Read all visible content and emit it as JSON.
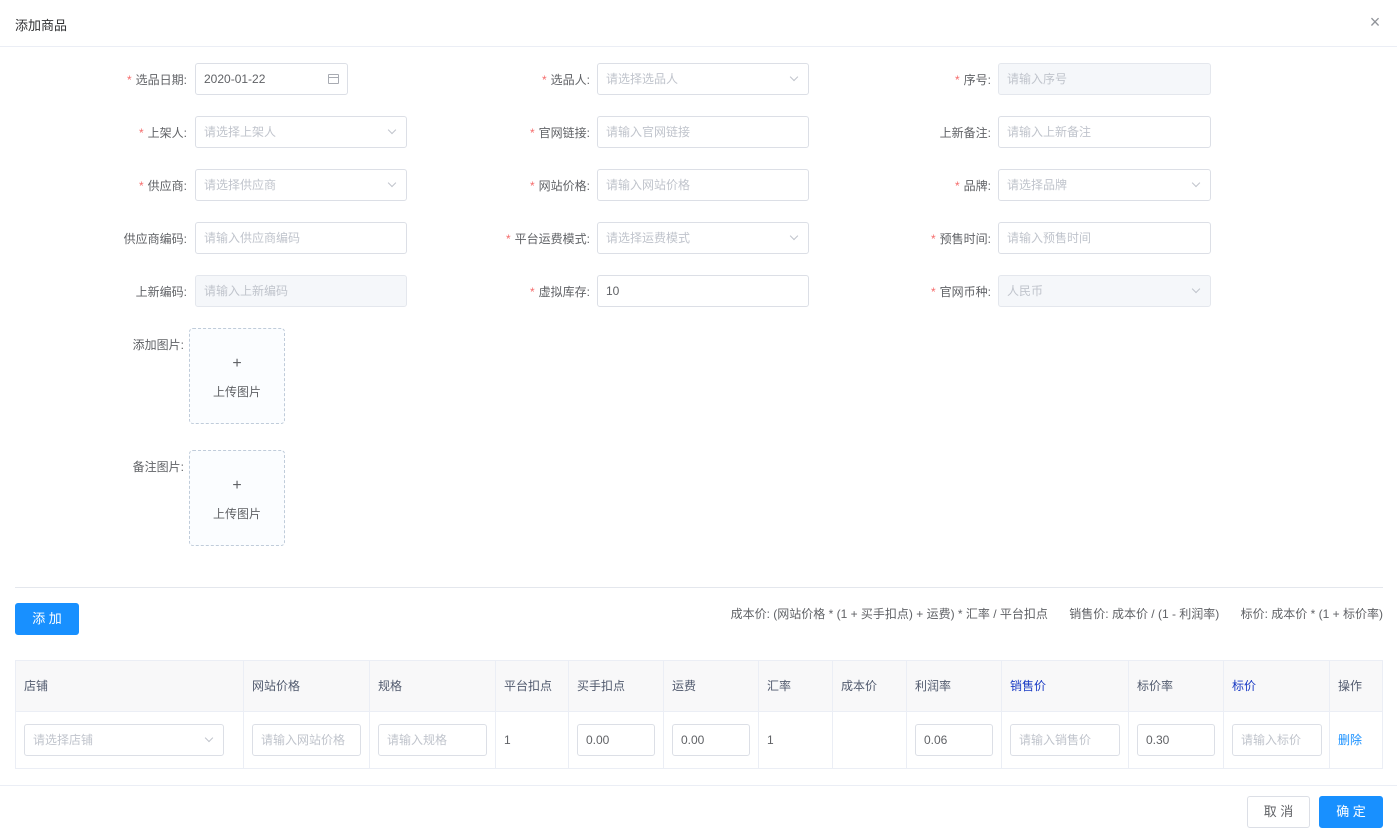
{
  "dialog": {
    "title": "添加商品"
  },
  "form": {
    "select_date": {
      "label": "选品日期",
      "value": "2020-01-22"
    },
    "selector": {
      "label": "选品人",
      "placeholder": "请选择选品人"
    },
    "serial": {
      "label": "序号",
      "placeholder": "请输入序号"
    },
    "shelver": {
      "label": "上架人",
      "placeholder": "请选择上架人"
    },
    "official_link": {
      "label": "官网链接",
      "placeholder": "请输入官网链接"
    },
    "new_remark": {
      "label": "上新备注",
      "placeholder": "请输入上新备注"
    },
    "supplier": {
      "label": "供应商",
      "placeholder": "请选择供应商"
    },
    "site_price": {
      "label": "网站价格",
      "placeholder": "请输入网站价格"
    },
    "brand": {
      "label": "品牌",
      "placeholder": "请选择品牌"
    },
    "supplier_code": {
      "label": "供应商编码",
      "placeholder": "请输入供应商编码"
    },
    "shipping_mode": {
      "label": "平台运费模式",
      "placeholder": "请选择运费模式"
    },
    "presale_time": {
      "label": "预售时间",
      "placeholder": "请输入预售时间"
    },
    "new_code": {
      "label": "上新编码",
      "placeholder": "请输入上新编码"
    },
    "virtual_stock": {
      "label": "虚拟库存",
      "value": "10"
    },
    "currency": {
      "label": "官网币种",
      "value": "人民币"
    },
    "add_image": {
      "label": "添加图片",
      "upload_text": "上传图片"
    },
    "remark_image": {
      "label": "备注图片",
      "upload_text": "上传图片"
    }
  },
  "add_button": "添 加",
  "formulas": {
    "cost": "成本价:   (网站价格 * (1 + 买手扣点) + 运费) * 汇率 / 平台扣点",
    "sale": "销售价:   成本价 / (1 - 利润率)",
    "tag": "标价:   成本价 * (1 + 标价率)"
  },
  "table": {
    "headers": [
      "店铺",
      "网站价格",
      "规格",
      "平台扣点",
      "买手扣点",
      "运费",
      "汇率",
      "成本价",
      "利润率",
      "销售价",
      "标价率",
      "标价",
      "操作"
    ],
    "row": {
      "shop_placeholder": "请选择店铺",
      "site_price_placeholder": "请输入网站价格",
      "spec_placeholder": "请输入规格",
      "platform_rate": "1",
      "buyer_rate": "0.00",
      "shipping": "0.00",
      "exchange_rate": "1",
      "cost_price": "",
      "profit_rate": "0.06",
      "sale_price_placeholder": "请输入销售价",
      "tag_rate": "0.30",
      "tag_price_placeholder": "请输入标价",
      "delete_label": "删除"
    }
  },
  "footer": {
    "cancel": "取 消",
    "confirm": "确 定"
  },
  "colors": {
    "primary": "#1890ff",
    "required": "#f56c6c",
    "header_link": "#1a3bc4"
  },
  "icons": {
    "close": "close-icon",
    "calendar": "calendar-icon",
    "dropdown": "chevron-down-icon",
    "upload": "plus-icon"
  }
}
